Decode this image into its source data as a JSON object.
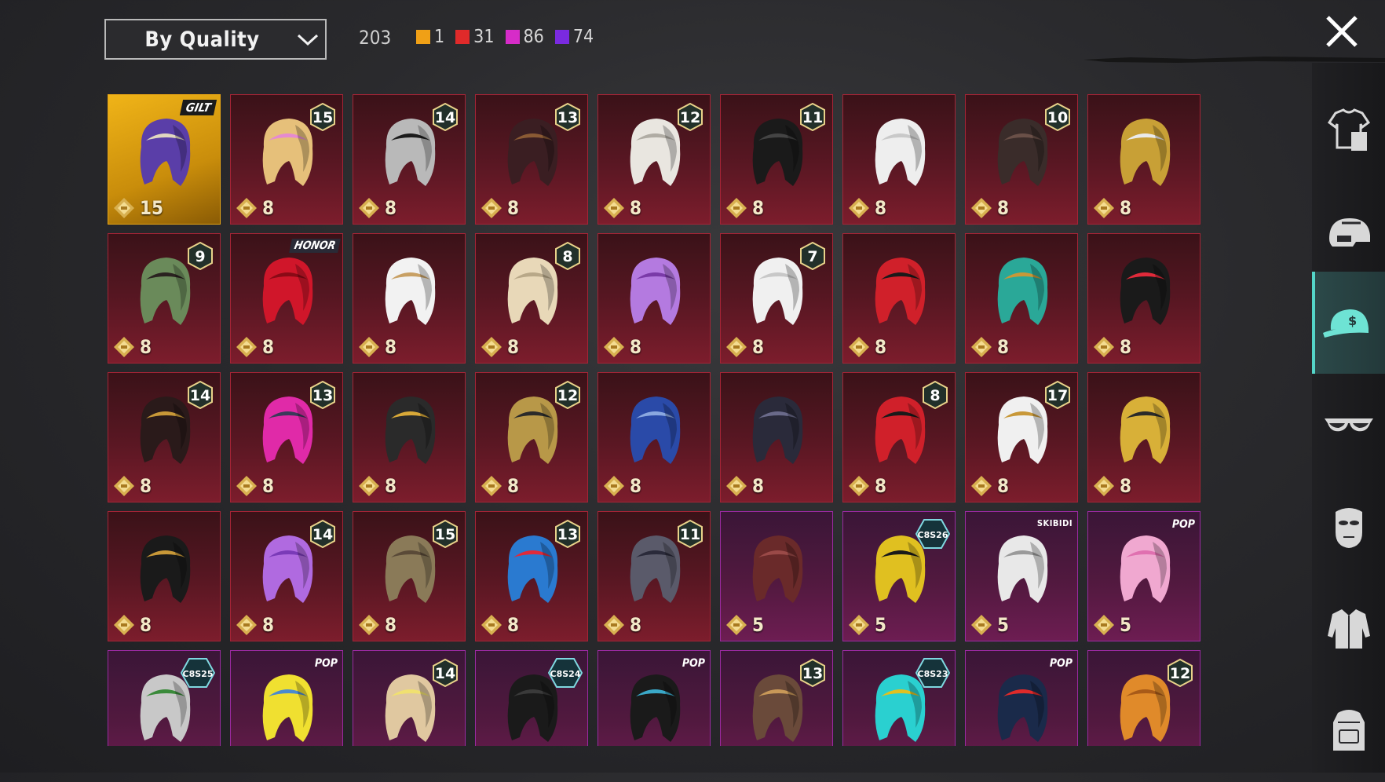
{
  "header": {
    "sort_label": "By Quality",
    "total": "203",
    "quality_counts": [
      {
        "color": "#f0a016",
        "count": "1"
      },
      {
        "color": "#e02a2a",
        "count": "31"
      },
      {
        "color": "#d62cc8",
        "count": "86"
      },
      {
        "color": "#7a2ae0",
        "count": "74"
      }
    ]
  },
  "sidebar": {
    "tabs": [
      "outfit-icon",
      "helmet-icon",
      "cap-icon",
      "glasses-icon",
      "mask-icon",
      "jacket-icon",
      "backpack-icon"
    ],
    "active": "cap-icon"
  },
  "grid": {
    "items": [
      {
        "quality": "gold",
        "points": "15",
        "badge": "GILT",
        "art": "double-skull-helmet"
      },
      {
        "quality": "red",
        "points": "8",
        "badge": "15",
        "art": "blonde-pink-hair"
      },
      {
        "quality": "red",
        "points": "8",
        "badge": "14",
        "art": "wolf-mask"
      },
      {
        "quality": "red",
        "points": "8",
        "badge": "13",
        "art": "hat-brown-hair"
      },
      {
        "quality": "red",
        "points": "8",
        "badge": "12",
        "art": "white-bunny-hair"
      },
      {
        "quality": "red",
        "points": "8",
        "badge": "11",
        "art": "black-helmet"
      },
      {
        "quality": "red",
        "points": "8",
        "badge": "",
        "art": "white-ghost-hair"
      },
      {
        "quality": "red",
        "points": "8",
        "badge": "10",
        "art": "dark-long-hair"
      },
      {
        "quality": "red",
        "points": "8",
        "badge": "",
        "art": "gold-mask-helmet"
      },
      {
        "quality": "red",
        "points": "8",
        "badge": "9",
        "art": "zombie-head"
      },
      {
        "quality": "red",
        "points": "8",
        "badge": "HONOR",
        "art": "red-long-hair"
      },
      {
        "quality": "red",
        "points": "8",
        "badge": "",
        "art": "white-cowboy-hat"
      },
      {
        "quality": "red",
        "points": "8",
        "badge": "8",
        "art": "blonde-bob-hair"
      },
      {
        "quality": "red",
        "points": "8",
        "badge": "",
        "art": "purple-ponytail"
      },
      {
        "quality": "red",
        "points": "8",
        "badge": "7",
        "art": "white-long-hair"
      },
      {
        "quality": "red",
        "points": "8",
        "badge": "",
        "art": "red-helmet"
      },
      {
        "quality": "red",
        "points": "8",
        "badge": "",
        "art": "teal-spiked-helmet"
      },
      {
        "quality": "red",
        "points": "8",
        "badge": "",
        "art": "red-horn-mask"
      },
      {
        "quality": "red",
        "points": "8",
        "badge": "14",
        "art": "pharaoh-dark-helmet"
      },
      {
        "quality": "red",
        "points": "8",
        "badge": "13",
        "art": "pink-dread-helmet"
      },
      {
        "quality": "red",
        "points": "8",
        "badge": "",
        "art": "anubis-helmet"
      },
      {
        "quality": "red",
        "points": "8",
        "badge": "12",
        "art": "winged-gold-helmet"
      },
      {
        "quality": "red",
        "points": "8",
        "badge": "",
        "art": "blue-feather-hair"
      },
      {
        "quality": "red",
        "points": "8",
        "badge": "",
        "art": "dark-knight-helmet"
      },
      {
        "quality": "red",
        "points": "8",
        "badge": "8",
        "art": "red-hat-mask"
      },
      {
        "quality": "red",
        "points": "8",
        "badge": "17",
        "art": "white-gold-helmet"
      },
      {
        "quality": "red",
        "points": "8",
        "badge": "",
        "art": "pharaoh-gold-helmet"
      },
      {
        "quality": "red",
        "points": "8",
        "badge": "",
        "art": "pharaoh-black-helmet"
      },
      {
        "quality": "red",
        "points": "8",
        "badge": "14",
        "art": "purple-fluffy-hair"
      },
      {
        "quality": "red",
        "points": "8",
        "badge": "15",
        "art": "knight-braid-helmet"
      },
      {
        "quality": "red",
        "points": "8",
        "badge": "13",
        "art": "blue-robot-helmet"
      },
      {
        "quality": "red",
        "points": "8",
        "badge": "11",
        "art": "gray-armor-helmet"
      },
      {
        "quality": "purple",
        "points": "5",
        "badge": "",
        "art": "brown-messy-hair"
      },
      {
        "quality": "purple",
        "points": "5",
        "badge": "C8S26",
        "art": "yellow-frog-hat"
      },
      {
        "quality": "purple",
        "points": "5",
        "badge": "SKIBIDI",
        "art": "camera-head"
      },
      {
        "quality": "purple",
        "points": "5",
        "badge": "POP",
        "art": "pink-bow-headband"
      },
      {
        "quality": "purple",
        "points": "",
        "badge": "C8S25",
        "art": "silver-bun-hair"
      },
      {
        "quality": "purple",
        "points": "",
        "badge": "POP",
        "art": "sponge-mask"
      },
      {
        "quality": "purple",
        "points": "",
        "badge": "14",
        "art": "blonde-flower-hair"
      },
      {
        "quality": "purple",
        "points": "",
        "badge": "C8S24",
        "art": "black-short-hair"
      },
      {
        "quality": "purple",
        "points": "",
        "badge": "POP",
        "art": "black-bow-hair"
      },
      {
        "quality": "purple",
        "points": "",
        "badge": "13",
        "art": "goggle-hair"
      },
      {
        "quality": "purple",
        "points": "",
        "badge": "C8S23",
        "art": "cat-headphones"
      },
      {
        "quality": "purple",
        "points": "",
        "badge": "POP",
        "art": "navy-cap"
      },
      {
        "quality": "purple",
        "points": "",
        "badge": "12",
        "art": "orange-pigtails"
      }
    ]
  }
}
